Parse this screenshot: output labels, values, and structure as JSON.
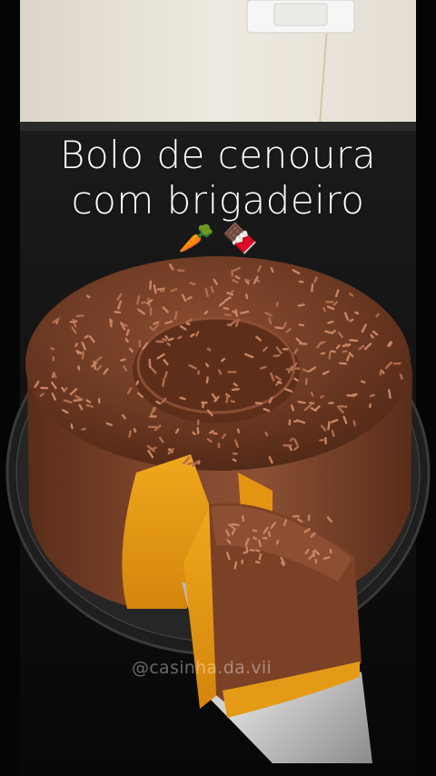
{
  "caption": {
    "line1": "Bolo de cenoura",
    "line2": "com brigadeiro",
    "emojis": [
      "carrot-emoji",
      "chocolate-bar-emoji"
    ]
  },
  "watermark": "@casinha.da.vii",
  "colors": {
    "wall": "#ece7dd",
    "countertop": "#121212",
    "chocolate": "#6e3a23",
    "sprinkles": "#c07a55",
    "cake_crumb": "#e79a14",
    "plate_glass": "#2a2a2a",
    "text": "#ffffff"
  }
}
